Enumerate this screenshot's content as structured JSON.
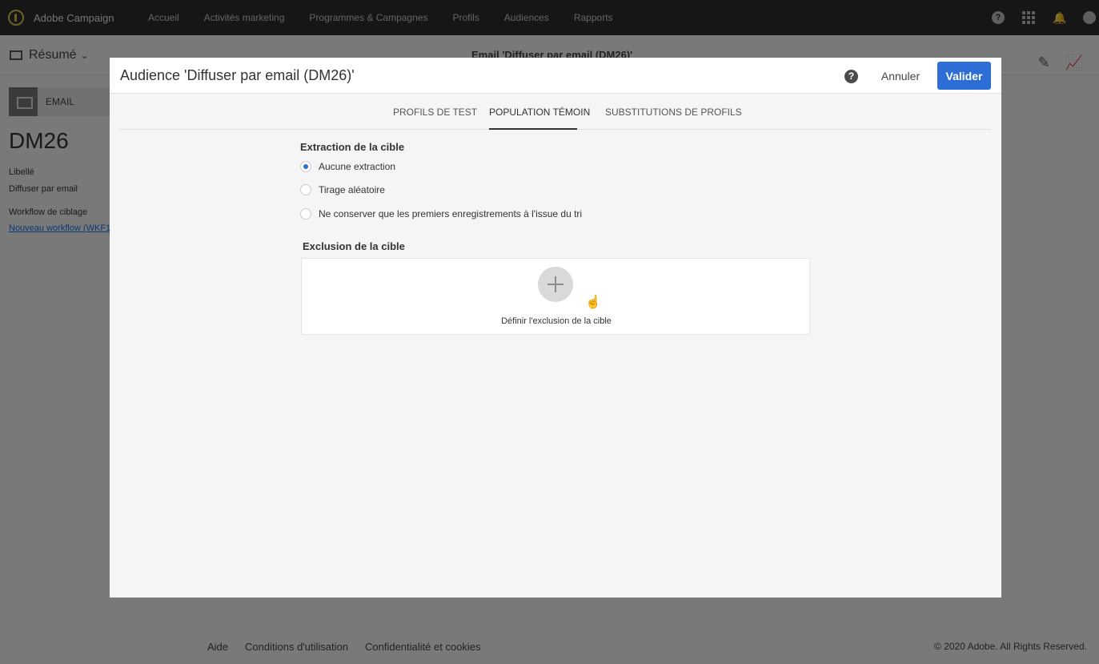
{
  "app": {
    "brand": "Adobe Campaign",
    "nav": [
      "Accueil",
      "Activités marketing",
      "Programmes & Campagnes",
      "Profils",
      "Audiences",
      "Rapports"
    ]
  },
  "page": {
    "view_label": "Résumé",
    "email_title": "Email 'Diffuser par email (DM26)'",
    "channel": "EMAIL",
    "code": "DM26",
    "fields": {
      "label_title": "Libellé",
      "label_value": "Diffuser par email",
      "workflow_title": "Workflow de ciblage",
      "workflow_link": "Nouveau workflow (WKF1"
    }
  },
  "footer": {
    "links": [
      "Aide",
      "Conditions d'utilisation",
      "Confidentialité et cookies"
    ],
    "copyright": "© 2020 Adobe. All Rights Reserved."
  },
  "dialog": {
    "title": "Audience 'Diffuser par email (DM26)'",
    "cancel_label": "Annuler",
    "ok_label": "Valider",
    "tabs": [
      {
        "label": "PROFILS DE TEST",
        "active": false
      },
      {
        "label": "POPULATION TÉMOIN",
        "active": true
      },
      {
        "label": "SUBSTITUTIONS DE PROFILS",
        "active": false
      }
    ],
    "extraction": {
      "title": "Extraction de la cible",
      "options": [
        {
          "label": "Aucune extraction",
          "checked": true
        },
        {
          "label": "Tirage aléatoire",
          "checked": false
        },
        {
          "label": "Ne conserver que les premiers enregistrements à l'issue du tri",
          "checked": false
        }
      ]
    },
    "exclusion": {
      "title": "Exclusion de la cible",
      "action_label": "Définir l'exclusion de la cible"
    }
  },
  "colors": {
    "accent": "#2d6ed6",
    "topbar": "#2d2d2d"
  },
  "icons": {
    "help": "help-icon",
    "apps": "apps-grid-icon",
    "notifications": "bell-icon",
    "user": "avatar-icon",
    "add": "plus-icon",
    "cursor": "hand-pointer-icon"
  }
}
